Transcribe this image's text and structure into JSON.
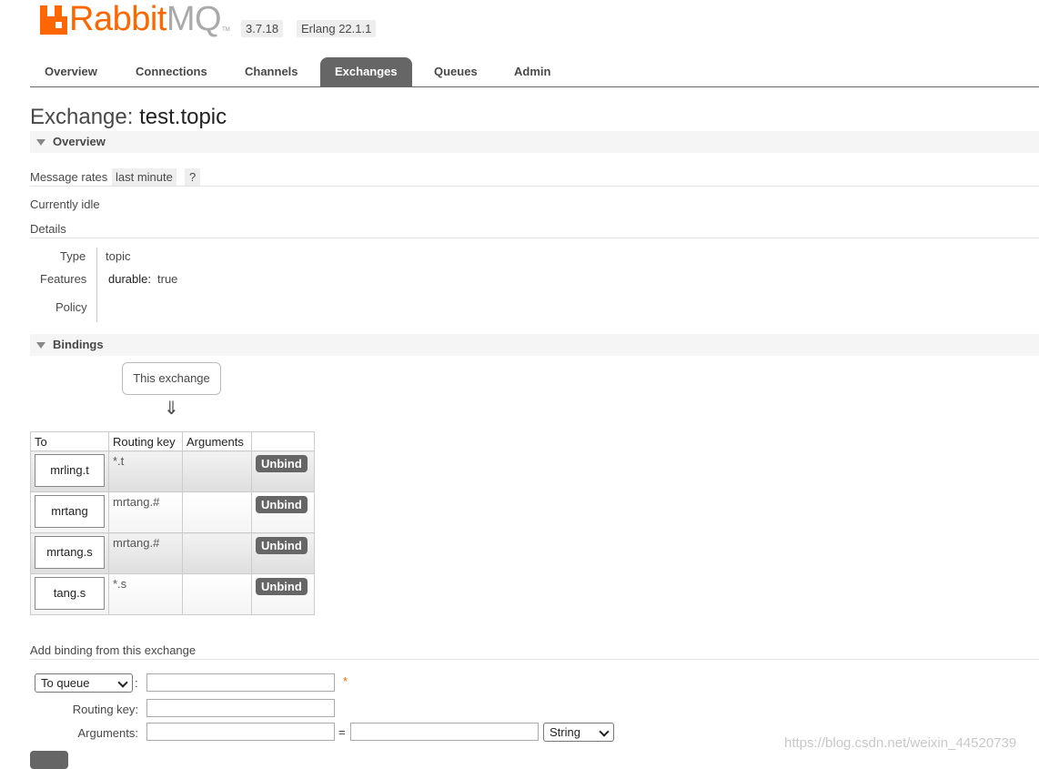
{
  "header": {
    "logo_rabbit": "Rabbit",
    "logo_mq": "MQ",
    "logo_tm": "TM",
    "version": "3.7.18",
    "erlang": "Erlang 22.1.1"
  },
  "nav": {
    "items": [
      "Overview",
      "Connections",
      "Channels",
      "Exchanges",
      "Queues",
      "Admin"
    ],
    "active": "Exchanges"
  },
  "page": {
    "title_prefix": "Exchange:",
    "title_name": "test.topic"
  },
  "overview": {
    "section_label": "Overview",
    "message_rates_label": "Message rates",
    "rate_period": "last minute",
    "help": "?",
    "status": "Currently idle",
    "details_label": "Details",
    "type_label": "Type",
    "type_value": "topic",
    "features_label": "Features",
    "feature_key": "durable:",
    "feature_value": "true",
    "policy_label": "Policy"
  },
  "bindings": {
    "section_label": "Bindings",
    "this_exchange": "This exchange",
    "arrow": "⇓",
    "columns": [
      "To",
      "Routing key",
      "Arguments",
      ""
    ],
    "rows": [
      {
        "to": "mrling.t",
        "routing_key": "*.t",
        "action": "Unbind"
      },
      {
        "to": "mrtang",
        "routing_key": "mrtang.#",
        "action": "Unbind"
      },
      {
        "to": "mrtang.s",
        "routing_key": "mrtang.#",
        "action": "Unbind"
      },
      {
        "to": "tang.s",
        "routing_key": "*.s",
        "action": "Unbind"
      }
    ]
  },
  "add_binding": {
    "heading": "Add binding from this exchange",
    "destination_type": "To queue",
    "colon": ":",
    "required_mark": "*",
    "routing_key_label": "Routing key:",
    "arguments_label": "Arguments:",
    "equals": "=",
    "arg_type": "String"
  },
  "watermark": "https://blog.csdn.net/weixin_44520739",
  "colors": {
    "brand_orange": "#ff6600",
    "nav_active": "#666666",
    "text": "#484848"
  }
}
